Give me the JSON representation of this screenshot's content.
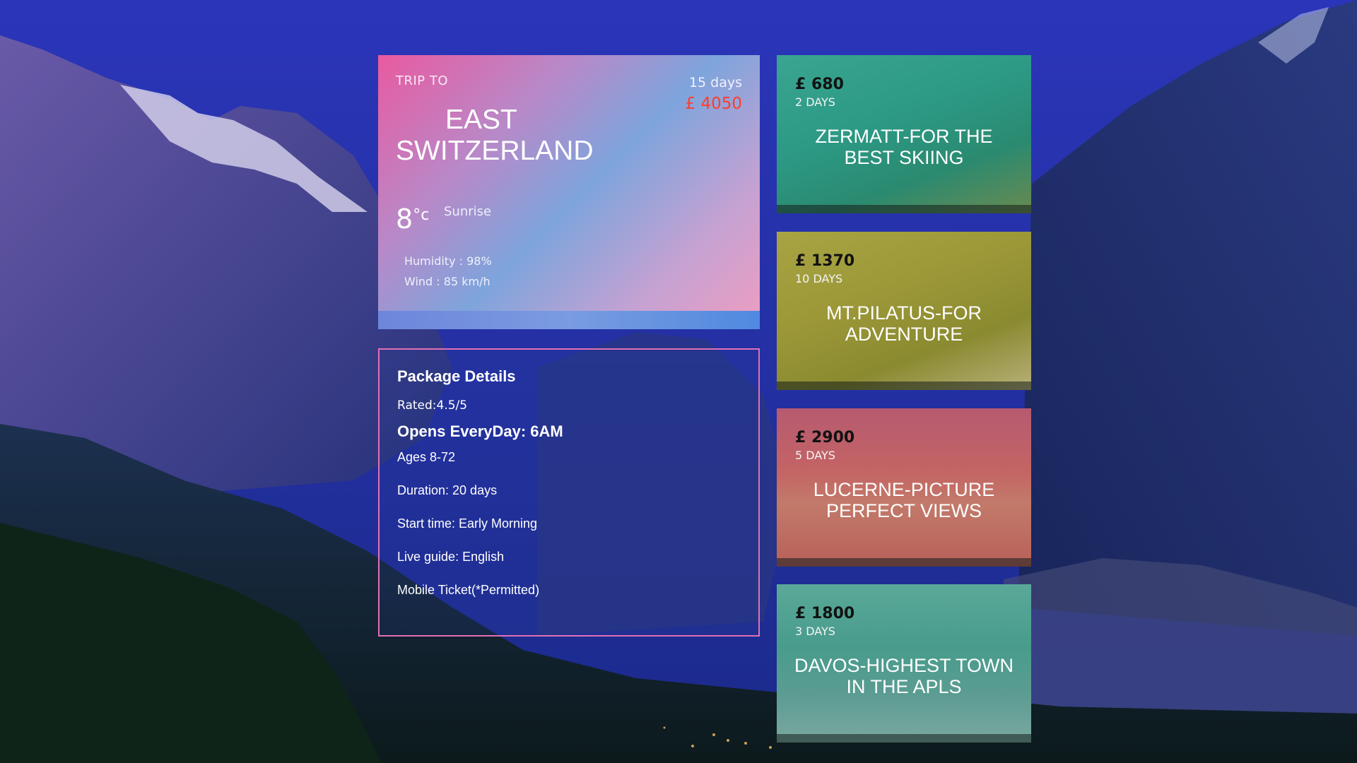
{
  "trip": {
    "label": "TRIP TO",
    "destination_line1": "EAST",
    "destination_line2": "SWITZERLAND",
    "days": "15 days",
    "price": "£ 4050",
    "temperature": "8",
    "temperature_unit": "°c",
    "condition": "Sunrise",
    "humidity": "Humidity : 98%",
    "wind": "Wind : 85 km/h"
  },
  "package": {
    "title": "Package Details",
    "rated": "Rated:4.5/5",
    "opens": "Opens EveryDay: 6AM",
    "ages": "Ages 8-72",
    "duration": "Duration: 20 days",
    "start_time": "Start time: Early Morning",
    "live_guide": "Live guide: English",
    "ticket": "Mobile Ticket(*Permitted)"
  },
  "destinations": [
    {
      "price": "£ 680",
      "days": "2 DAYS",
      "name": "ZERMATT-FOR THE BEST SKIING",
      "tint": "#2a9c84"
    },
    {
      "price": "£ 1370",
      "days": "10 DAYS",
      "name": "MT.PILATUS-FOR ADVENTURE",
      "tint": "#9c9830"
    },
    {
      "price": "£ 2900",
      "days": "5 DAYS",
      "name": "LUCERNE-PICTURE PERFECT VIEWS",
      "tint": "#c45a5a"
    },
    {
      "price": "£ 1800",
      "days": "3 DAYS",
      "name": "DAVOS-HIGHEST TOWN IN THE APLS",
      "tint": "#3e9c8c"
    }
  ],
  "colors": {
    "accent_price": "#ff3d2c",
    "package_border": "#e071b5"
  }
}
